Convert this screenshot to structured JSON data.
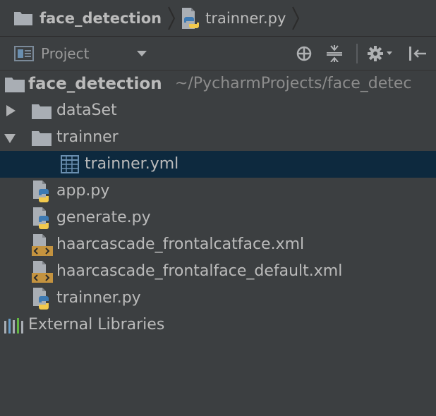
{
  "breadcrumb": {
    "project": "face_detection",
    "file": "trainner.py"
  },
  "toolwindow": {
    "title": "Project",
    "icons": [
      "project-view-icon",
      "dropdown-arrow-icon",
      "locate-icon",
      "collapse-all-icon",
      "gear-icon",
      "hide-icon"
    ]
  },
  "tree": {
    "root": {
      "label": "face_detection",
      "path": "~/PycharmProjects/face_detec"
    },
    "items": [
      {
        "label": "dataSet",
        "type": "folder",
        "expanded": false
      },
      {
        "label": "trainner",
        "type": "folder",
        "expanded": true
      },
      {
        "label": "trainner.yml",
        "type": "yml",
        "selected": true
      },
      {
        "label": "app.py",
        "type": "python"
      },
      {
        "label": "generate.py",
        "type": "python"
      },
      {
        "label": "haarcascade_frontalcatface.xml",
        "type": "xml"
      },
      {
        "label": "haarcascade_frontalface_default.xml",
        "type": "xml"
      },
      {
        "label": "trainner.py",
        "type": "python"
      }
    ],
    "external": "External Libraries"
  },
  "colors": {
    "background": "#3c3f41",
    "selection": "#0d293e",
    "text": "#bbbbbb",
    "folder": "#a9aeb4",
    "python_blue": "#3d7ab3",
    "python_yellow": "#f2c94c",
    "xml_badge": "#c4933f"
  }
}
